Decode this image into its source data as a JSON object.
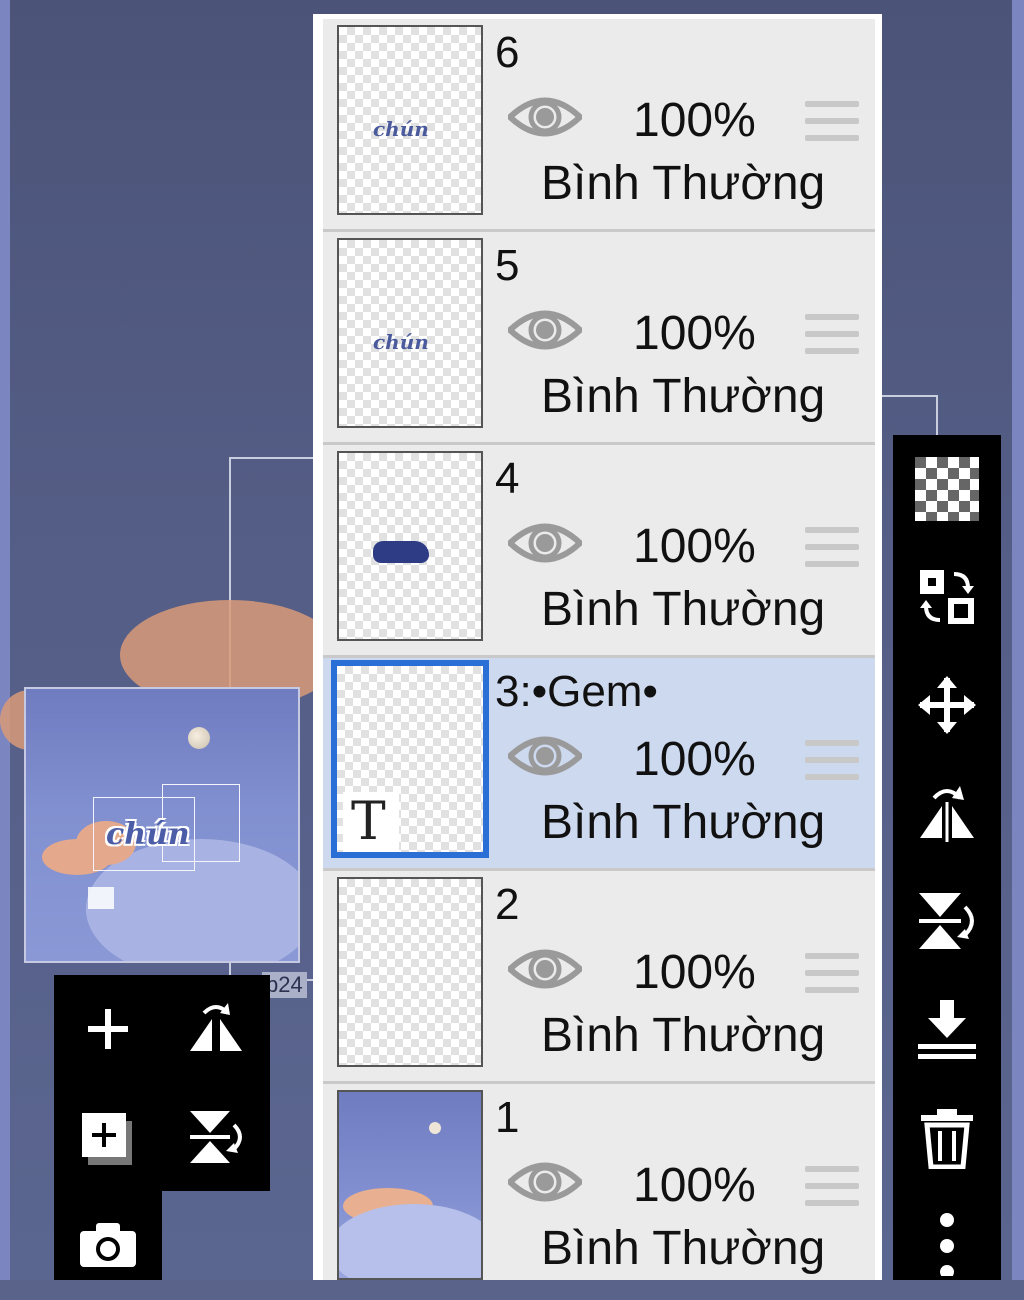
{
  "layers": [
    {
      "name": "6",
      "opacity": "100%",
      "blend": "Bình Thường",
      "selected": false,
      "thumb_text": "chún"
    },
    {
      "name": "5",
      "opacity": "100%",
      "blend": "Bình Thường",
      "selected": false,
      "thumb_text": "chún"
    },
    {
      "name": "4",
      "opacity": "100%",
      "blend": "Bình Thường",
      "selected": false,
      "thumb_text": ""
    },
    {
      "name": "3:•Gem•",
      "opacity": "100%",
      "blend": "Bình Thường",
      "selected": true,
      "thumb_text": "T"
    },
    {
      "name": "2",
      "opacity": "100%",
      "blend": "Bình Thường",
      "selected": false,
      "thumb_text": ""
    },
    {
      "name": "1",
      "opacity": "100%",
      "blend": "Bình Thường",
      "selected": false,
      "thumb_text": ""
    }
  ],
  "preview": {
    "word": "chún"
  },
  "background": {
    "partial_label": "p24"
  },
  "left_tools": [
    "add-layer-icon",
    "flip-horizontal-icon",
    "add-copy-layer-icon",
    "flip-vertical-icon",
    "camera-icon"
  ],
  "right_tools": [
    "transparency-icon",
    "swap-icon",
    "move-icon",
    "flip-horizontal-icon",
    "flip-vertical-icon",
    "merge-down-icon",
    "trash-icon",
    "more-icon"
  ],
  "colors": {
    "selected_row": "#cdd9ee",
    "selected_border": "#2a6fd6",
    "row": "#ebebeb",
    "toolbar": "#000000"
  }
}
